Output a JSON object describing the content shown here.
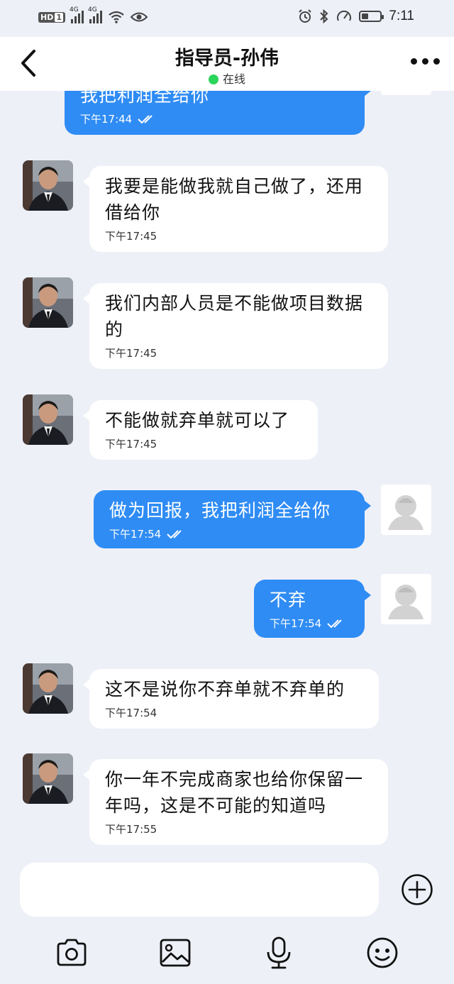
{
  "status_bar": {
    "hd": "HD",
    "sim": "1",
    "net1": "4G",
    "net2": "4G",
    "time": "7:11"
  },
  "header": {
    "title": "指导员-孙伟",
    "status": "在线"
  },
  "messages": [
    {
      "dir": "out",
      "text": "我把利润全给你",
      "time": "下午17:44",
      "read": true
    },
    {
      "dir": "in",
      "text": "我要是能做我就自己做了，还用借给你",
      "time": "下午17:45"
    },
    {
      "dir": "in",
      "text": "我们内部人员是不能做项目数据的",
      "time": "下午17:45"
    },
    {
      "dir": "in",
      "text": "不能做就弃单就可以了",
      "time": "下午17:45"
    },
    {
      "dir": "out",
      "text": "做为回报，我把利润全给你",
      "time": "下午17:54",
      "read": true
    },
    {
      "dir": "out",
      "text": "不弃",
      "time": "下午17:54",
      "read": true
    },
    {
      "dir": "in",
      "text": "这不是说你不弃单就不弃单的",
      "time": "下午17:54"
    },
    {
      "dir": "in",
      "text": "你一年不完成商家也给你保留一年吗，这是不可能的知道吗",
      "time": "下午17:55"
    }
  ],
  "icons": {
    "back": "chevron-left-icon",
    "more": "more-dots-icon",
    "plus": "plus-circle-icon",
    "camera": "camera-icon",
    "image": "image-icon",
    "mic": "microphone-icon",
    "emoji": "emoji-icon"
  },
  "colors": {
    "outgoing_bubble": "#2f8cf4",
    "incoming_bubble": "#ffffff",
    "online_dot": "#2bd45a",
    "background": "#eef0f8"
  }
}
